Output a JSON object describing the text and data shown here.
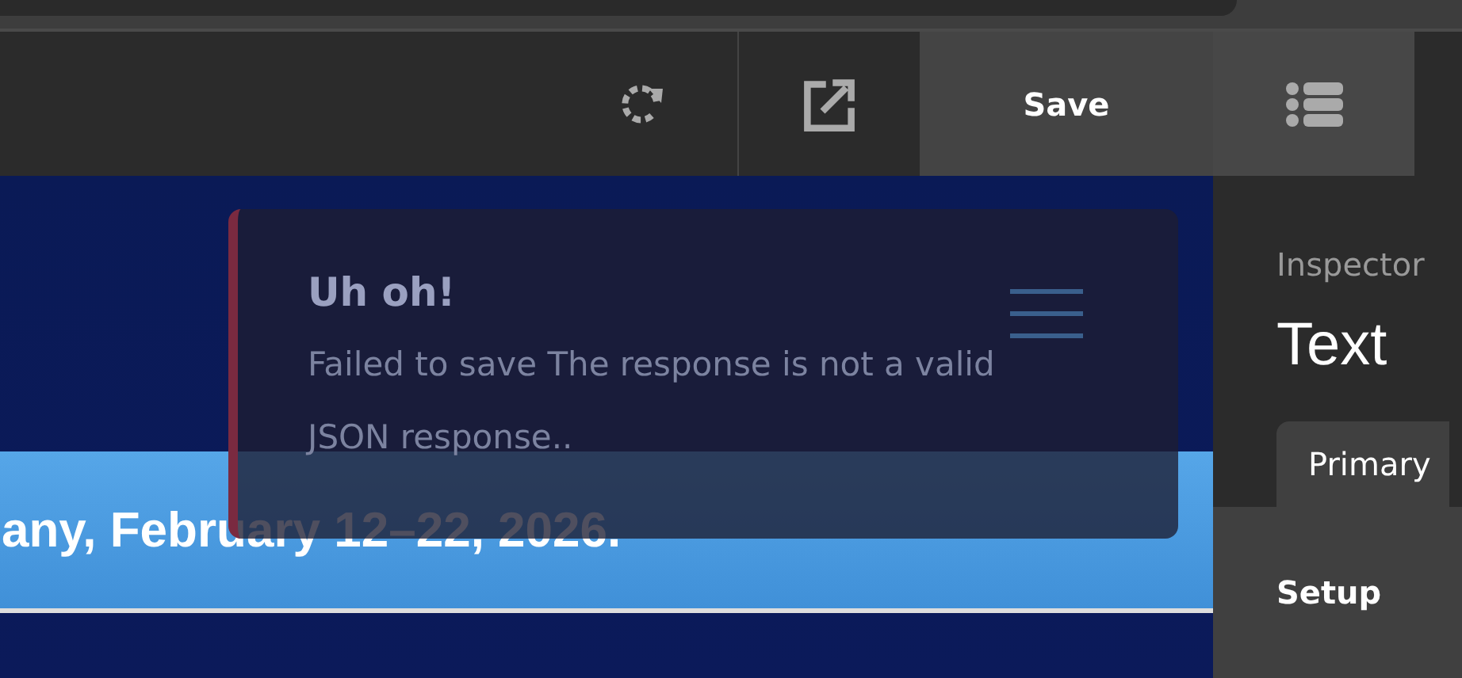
{
  "toolbar": {
    "save_label": "Save"
  },
  "canvas": {
    "banner_text": "any, February 12–22, 2026."
  },
  "toast": {
    "title": "Uh oh!",
    "message": "Failed to save The response is not a valid JSON response.."
  },
  "inspector": {
    "heading": "Inspector",
    "title": "Text",
    "tabs": [
      {
        "label": "Primary",
        "selected": true
      }
    ],
    "section": "Setup"
  }
}
